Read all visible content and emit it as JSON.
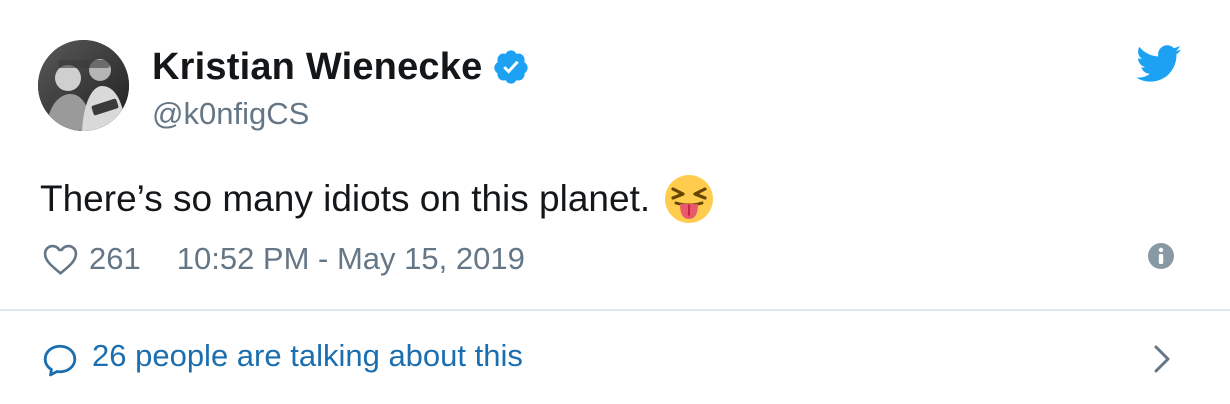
{
  "author": {
    "display_name": "Kristian Wienecke",
    "handle": "@k0nfigCS",
    "verified": true
  },
  "tweet": {
    "text": "There’s so many idiots on this planet.",
    "emoji": "squinting-face-with-tongue"
  },
  "meta": {
    "like_count": "261",
    "timestamp": "10:52 PM - May 15, 2019"
  },
  "conversation": {
    "label": "26 people are talking about this"
  },
  "colors": {
    "text": "#14171a",
    "secondary": "#657786",
    "link": "#1b6fb0",
    "brand": "#1da1f2",
    "verified": "#1da1f2",
    "divider": "#e1e8ed"
  },
  "icons": [
    "avatar",
    "verified-badge-icon",
    "twitter-bird-icon",
    "emoji-icon",
    "heart-icon",
    "info-icon",
    "speech-bubble-icon",
    "chevron-right-icon"
  ]
}
